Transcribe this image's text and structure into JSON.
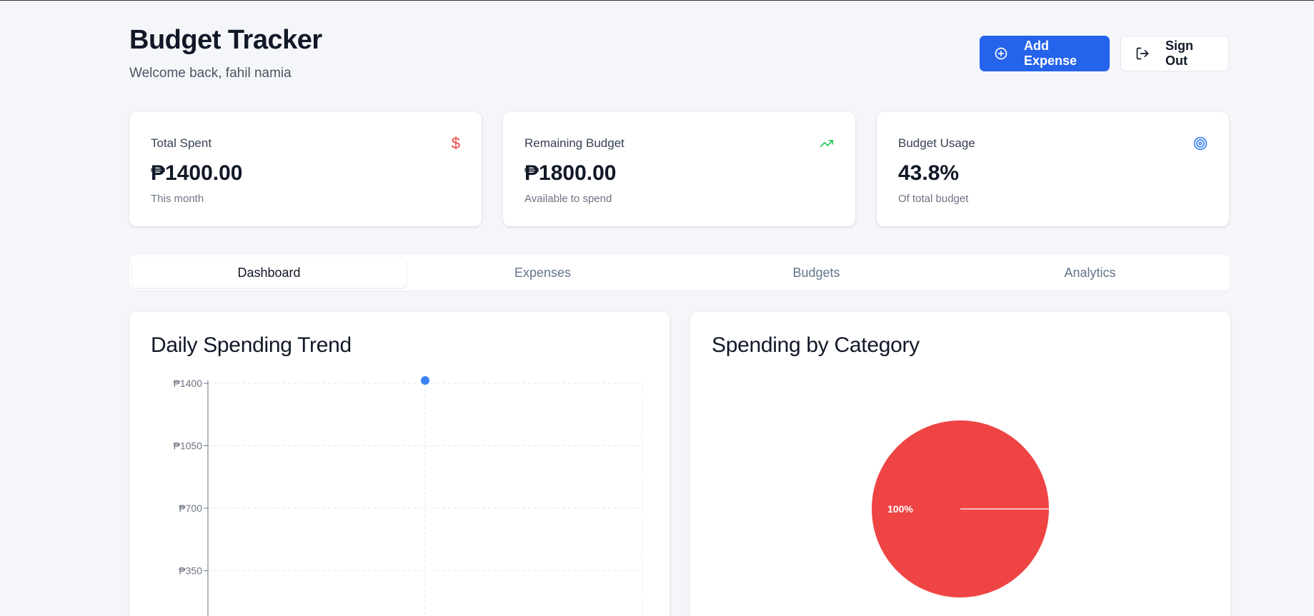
{
  "header": {
    "title": "Budget Tracker",
    "welcome": "Welcome back, fahil namia"
  },
  "actions": {
    "add_expense": "Add Expense",
    "sign_out": "Sign Out"
  },
  "stats": [
    {
      "label": "Total Spent",
      "value": "₱1400.00",
      "sub": "This month",
      "icon": "dollar-icon",
      "icon_color": "#ef4444"
    },
    {
      "label": "Remaining Budget",
      "value": "₱1800.00",
      "sub": "Available to spend",
      "icon": "trending-up-icon",
      "icon_color": "#22c55e"
    },
    {
      "label": "Budget Usage",
      "value": "43.8%",
      "sub": "Of total budget",
      "icon": "target-icon",
      "icon_color": "#3b82f6"
    }
  ],
  "tabs": [
    {
      "label": "Dashboard",
      "active": true
    },
    {
      "label": "Expenses",
      "active": false
    },
    {
      "label": "Budgets",
      "active": false
    },
    {
      "label": "Analytics",
      "active": false
    }
  ],
  "colors": {
    "primary": "#2563eb",
    "line": "#3b82f6",
    "pie": "#ef4444"
  },
  "chart_data": [
    {
      "type": "line",
      "title": "Daily Spending Trend",
      "y_ticks": [
        "₱1400",
        "₱1050",
        "₱700",
        "₱350"
      ],
      "y_tick_values": [
        1400,
        1050,
        700,
        350
      ],
      "ylim": [
        0,
        1400
      ],
      "series": [
        {
          "values": [
            1400
          ]
        }
      ],
      "grid": true
    },
    {
      "type": "pie",
      "title": "Spending by Category",
      "slices": [
        {
          "value": 100,
          "label": "100%"
        }
      ]
    }
  ]
}
